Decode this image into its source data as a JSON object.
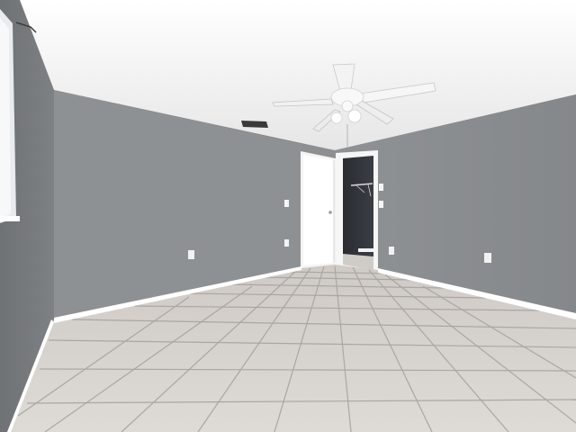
{
  "scene": {
    "kind": "empty-bedroom-interior",
    "objects": [
      "ceiling-fan",
      "air-vent",
      "interior-door",
      "walk-in-closet",
      "closet-rod",
      "window",
      "light-switch",
      "electrical-outlet",
      "baseboard",
      "floor-tiles"
    ]
  },
  "colors": {
    "ceiling": "#f2f2f2",
    "back_wall": "#8f9295",
    "right_wall": "#8b8e91",
    "left_wall": "#7c7f82",
    "near_left_wall": "#86898c",
    "floor": "#d9d5d1",
    "grout": "#a9a5a2",
    "trim": "#ffffff",
    "closet_dark": "#2b2d33",
    "fan_white": "#f4f4f4"
  }
}
